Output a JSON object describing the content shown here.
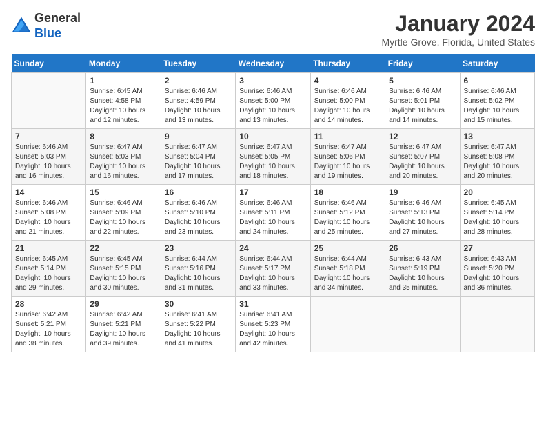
{
  "header": {
    "logo_line1": "General",
    "logo_line2": "Blue",
    "month": "January 2024",
    "location": "Myrtle Grove, Florida, United States"
  },
  "weekdays": [
    "Sunday",
    "Monday",
    "Tuesday",
    "Wednesday",
    "Thursday",
    "Friday",
    "Saturday"
  ],
  "weeks": [
    [
      {
        "num": "",
        "info": ""
      },
      {
        "num": "1",
        "info": "Sunrise: 6:45 AM\nSunset: 4:58 PM\nDaylight: 10 hours\nand 12 minutes."
      },
      {
        "num": "2",
        "info": "Sunrise: 6:46 AM\nSunset: 4:59 PM\nDaylight: 10 hours\nand 13 minutes."
      },
      {
        "num": "3",
        "info": "Sunrise: 6:46 AM\nSunset: 5:00 PM\nDaylight: 10 hours\nand 13 minutes."
      },
      {
        "num": "4",
        "info": "Sunrise: 6:46 AM\nSunset: 5:00 PM\nDaylight: 10 hours\nand 14 minutes."
      },
      {
        "num": "5",
        "info": "Sunrise: 6:46 AM\nSunset: 5:01 PM\nDaylight: 10 hours\nand 14 minutes."
      },
      {
        "num": "6",
        "info": "Sunrise: 6:46 AM\nSunset: 5:02 PM\nDaylight: 10 hours\nand 15 minutes."
      }
    ],
    [
      {
        "num": "7",
        "info": "Sunrise: 6:46 AM\nSunset: 5:03 PM\nDaylight: 10 hours\nand 16 minutes."
      },
      {
        "num": "8",
        "info": "Sunrise: 6:47 AM\nSunset: 5:03 PM\nDaylight: 10 hours\nand 16 minutes."
      },
      {
        "num": "9",
        "info": "Sunrise: 6:47 AM\nSunset: 5:04 PM\nDaylight: 10 hours\nand 17 minutes."
      },
      {
        "num": "10",
        "info": "Sunrise: 6:47 AM\nSunset: 5:05 PM\nDaylight: 10 hours\nand 18 minutes."
      },
      {
        "num": "11",
        "info": "Sunrise: 6:47 AM\nSunset: 5:06 PM\nDaylight: 10 hours\nand 19 minutes."
      },
      {
        "num": "12",
        "info": "Sunrise: 6:47 AM\nSunset: 5:07 PM\nDaylight: 10 hours\nand 20 minutes."
      },
      {
        "num": "13",
        "info": "Sunrise: 6:47 AM\nSunset: 5:08 PM\nDaylight: 10 hours\nand 20 minutes."
      }
    ],
    [
      {
        "num": "14",
        "info": "Sunrise: 6:46 AM\nSunset: 5:08 PM\nDaylight: 10 hours\nand 21 minutes."
      },
      {
        "num": "15",
        "info": "Sunrise: 6:46 AM\nSunset: 5:09 PM\nDaylight: 10 hours\nand 22 minutes."
      },
      {
        "num": "16",
        "info": "Sunrise: 6:46 AM\nSunset: 5:10 PM\nDaylight: 10 hours\nand 23 minutes."
      },
      {
        "num": "17",
        "info": "Sunrise: 6:46 AM\nSunset: 5:11 PM\nDaylight: 10 hours\nand 24 minutes."
      },
      {
        "num": "18",
        "info": "Sunrise: 6:46 AM\nSunset: 5:12 PM\nDaylight: 10 hours\nand 25 minutes."
      },
      {
        "num": "19",
        "info": "Sunrise: 6:46 AM\nSunset: 5:13 PM\nDaylight: 10 hours\nand 27 minutes."
      },
      {
        "num": "20",
        "info": "Sunrise: 6:45 AM\nSunset: 5:14 PM\nDaylight: 10 hours\nand 28 minutes."
      }
    ],
    [
      {
        "num": "21",
        "info": "Sunrise: 6:45 AM\nSunset: 5:14 PM\nDaylight: 10 hours\nand 29 minutes."
      },
      {
        "num": "22",
        "info": "Sunrise: 6:45 AM\nSunset: 5:15 PM\nDaylight: 10 hours\nand 30 minutes."
      },
      {
        "num": "23",
        "info": "Sunrise: 6:44 AM\nSunset: 5:16 PM\nDaylight: 10 hours\nand 31 minutes."
      },
      {
        "num": "24",
        "info": "Sunrise: 6:44 AM\nSunset: 5:17 PM\nDaylight: 10 hours\nand 33 minutes."
      },
      {
        "num": "25",
        "info": "Sunrise: 6:44 AM\nSunset: 5:18 PM\nDaylight: 10 hours\nand 34 minutes."
      },
      {
        "num": "26",
        "info": "Sunrise: 6:43 AM\nSunset: 5:19 PM\nDaylight: 10 hours\nand 35 minutes."
      },
      {
        "num": "27",
        "info": "Sunrise: 6:43 AM\nSunset: 5:20 PM\nDaylight: 10 hours\nand 36 minutes."
      }
    ],
    [
      {
        "num": "28",
        "info": "Sunrise: 6:42 AM\nSunset: 5:21 PM\nDaylight: 10 hours\nand 38 minutes."
      },
      {
        "num": "29",
        "info": "Sunrise: 6:42 AM\nSunset: 5:21 PM\nDaylight: 10 hours\nand 39 minutes."
      },
      {
        "num": "30",
        "info": "Sunrise: 6:41 AM\nSunset: 5:22 PM\nDaylight: 10 hours\nand 41 minutes."
      },
      {
        "num": "31",
        "info": "Sunrise: 6:41 AM\nSunset: 5:23 PM\nDaylight: 10 hours\nand 42 minutes."
      },
      {
        "num": "",
        "info": ""
      },
      {
        "num": "",
        "info": ""
      },
      {
        "num": "",
        "info": ""
      }
    ]
  ]
}
